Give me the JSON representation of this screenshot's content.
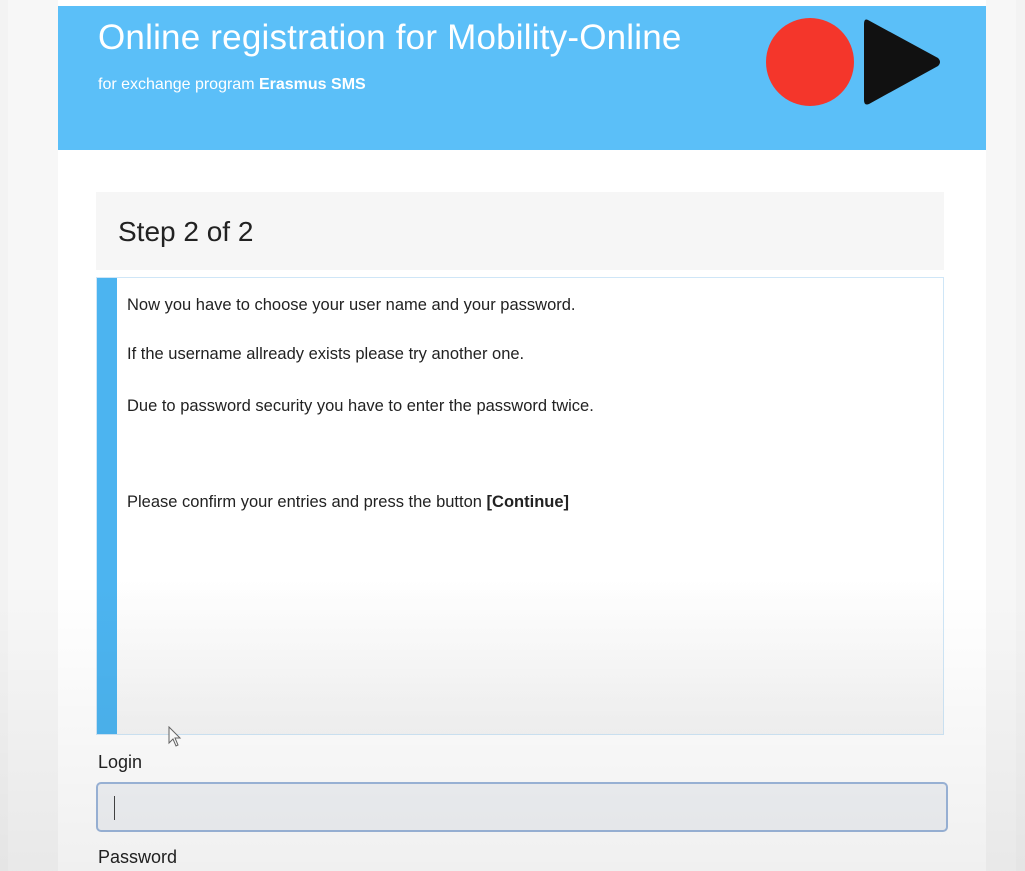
{
  "header": {
    "title": "Online registration for Mobility-Online",
    "subtitle_prefix": "for exchange program",
    "subtitle_program": "Erasmus SMS",
    "logo_icons": [
      "red-circle-icon",
      "play-triangle-icon"
    ],
    "colors": {
      "banner": "#5bbff8",
      "logo_red": "#f4362b",
      "logo_black": "#111111"
    }
  },
  "step": {
    "title": "Step 2 of 2"
  },
  "info": {
    "line1": "Now you have to choose your user name and your password.",
    "line2": "If the username allready exists please try another one.",
    "line3": "Due to password security you have to enter the password twice.",
    "line4_prefix": "Please confirm your entries and press the button",
    "line4_button": "[Continue]",
    "accent_color": "#4cb4f0"
  },
  "form": {
    "login_label": "Login",
    "login_value": "",
    "password_label": "Password"
  }
}
